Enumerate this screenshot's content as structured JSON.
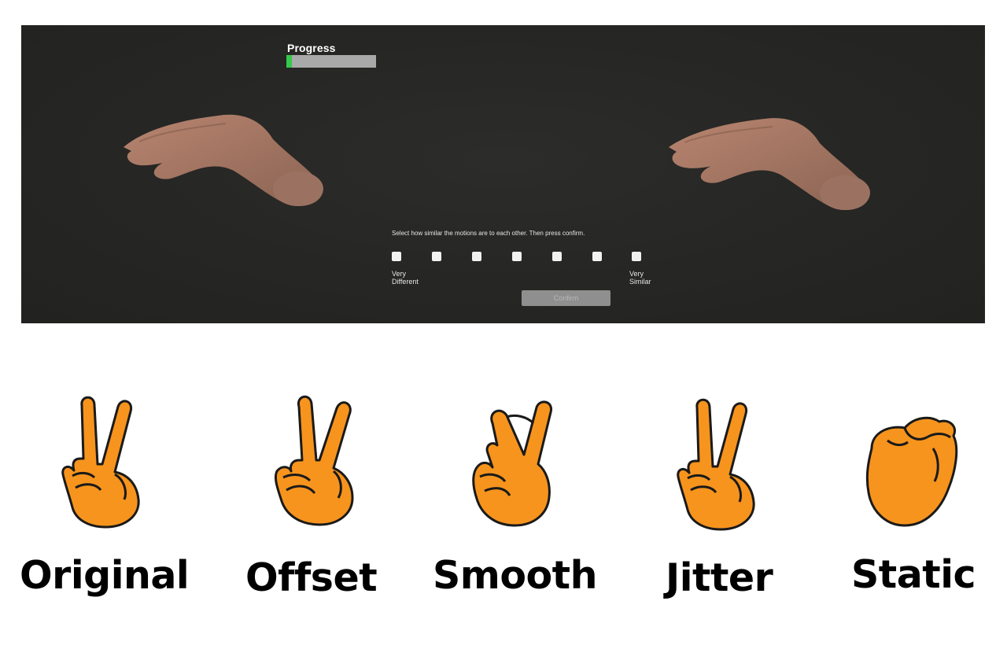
{
  "scene": {
    "progress_label": "Progress",
    "progress_fraction": 0.06,
    "question": "Select how similar the motions are to each other. Then press confirm.",
    "scale_points": 7,
    "anchor_left_line1": "Very",
    "anchor_left_line2": "Different",
    "anchor_right_line1": "Very",
    "anchor_right_line2": "Similar",
    "confirm_label": "Confirm"
  },
  "conditions": [
    {
      "label": "Original",
      "icon": "peace-sign-hand-icon"
    },
    {
      "label": "Offset",
      "icon": "peace-sign-hand-icon"
    },
    {
      "label": "Smooth",
      "icon": "crossed-fingers-hand-icon"
    },
    {
      "label": "Jitter",
      "icon": "peace-sign-hand-icon"
    },
    {
      "label": "Static",
      "icon": "closed-hand-icon"
    }
  ],
  "colors": {
    "hand_fill": "#F7941D",
    "hand_outline": "#1A1A1A",
    "progress_fill": "#35C84A",
    "progress_track": "#A9A9A9",
    "scene_background": "#272725"
  }
}
